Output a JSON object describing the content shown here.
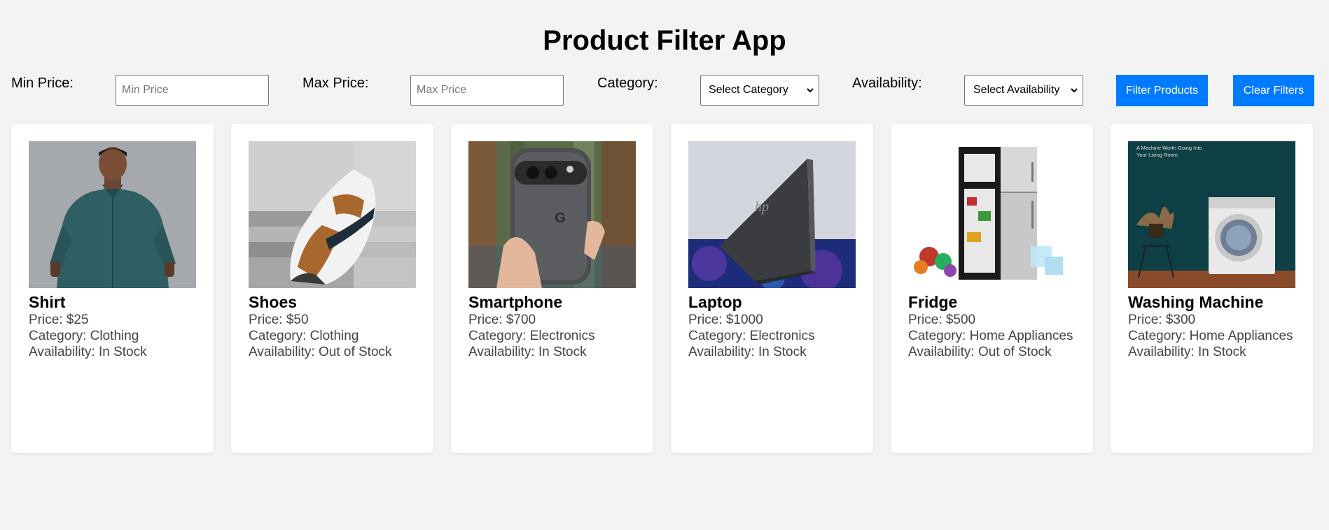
{
  "title": "Product Filter App",
  "filters": {
    "min_price_label": "Min Price:",
    "min_price_placeholder": "Min Price",
    "min_price_value": "",
    "max_price_label": "Max Price:",
    "max_price_placeholder": "Max Price",
    "max_price_value": "",
    "category_label": "Category:",
    "category_selected": "Select Category",
    "availability_label": "Availability:",
    "availability_selected": "Select Availability",
    "filter_button": "Filter Products",
    "clear_button": "Clear Filters"
  },
  "colors": {
    "accent": "#007bff",
    "background": "#f3f3f3",
    "card": "#ffffff"
  },
  "products": [
    {
      "name": "Shirt",
      "price": "Price: $25",
      "category": "Category: Clothing",
      "availability": "Availability: In Stock",
      "image": "shirt-photo"
    },
    {
      "name": "Shoes",
      "price": "Price: $50",
      "category": "Category: Clothing",
      "availability": "Availability: Out of Stock",
      "image": "shoes-photo"
    },
    {
      "name": "Smartphone",
      "price": "Price: $700",
      "category": "Category: Electronics",
      "availability": "Availability: In Stock",
      "image": "smartphone-photo"
    },
    {
      "name": "Laptop",
      "price": "Price: $1000",
      "category": "Category: Electronics",
      "availability": "Availability: In Stock",
      "image": "laptop-photo"
    },
    {
      "name": "Fridge",
      "price": "Price: $500",
      "category": "Category: Home Appliances",
      "availability": "Availability: Out of Stock",
      "image": "fridge-photo"
    },
    {
      "name": "Washing Machine",
      "price": "Price: $300",
      "category": "Category: Home Appliances",
      "availability": "Availability: In Stock",
      "image": "washing-machine-photo",
      "image_caption": "A Machine Worth Going Into Your Living Room"
    }
  ]
}
